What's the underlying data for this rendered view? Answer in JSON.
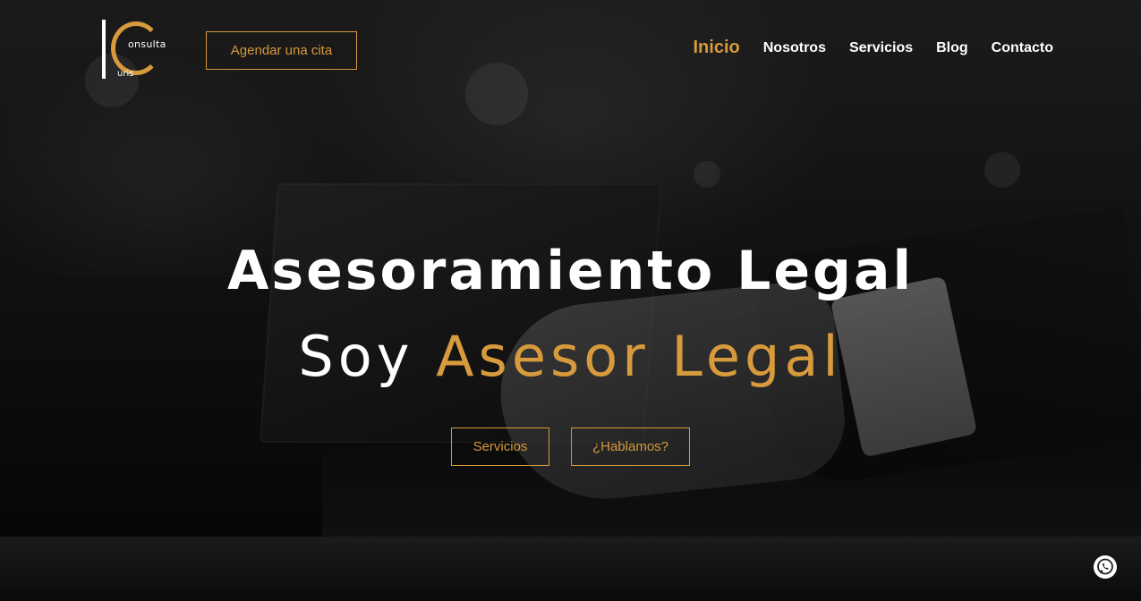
{
  "brand": {
    "logo_top": "onsulta",
    "logo_bottom": "uris",
    "accent_color": "#d79a3c"
  },
  "header": {
    "cta_label": "Agendar una cita",
    "nav": [
      {
        "label": "Inicio",
        "active": true
      },
      {
        "label": "Nosotros"
      },
      {
        "label": "Servicios"
      },
      {
        "label": "Blog"
      },
      {
        "label": "Contacto"
      }
    ]
  },
  "hero": {
    "headline": "Asesoramiento Legal",
    "subline_prefix": "Soy ",
    "subline_accent": "Asesor Legal",
    "buttons": [
      {
        "label": "Servicios"
      },
      {
        "label": "¿Hablamos?"
      }
    ]
  },
  "floating": {
    "icon": "whatsapp-icon"
  }
}
